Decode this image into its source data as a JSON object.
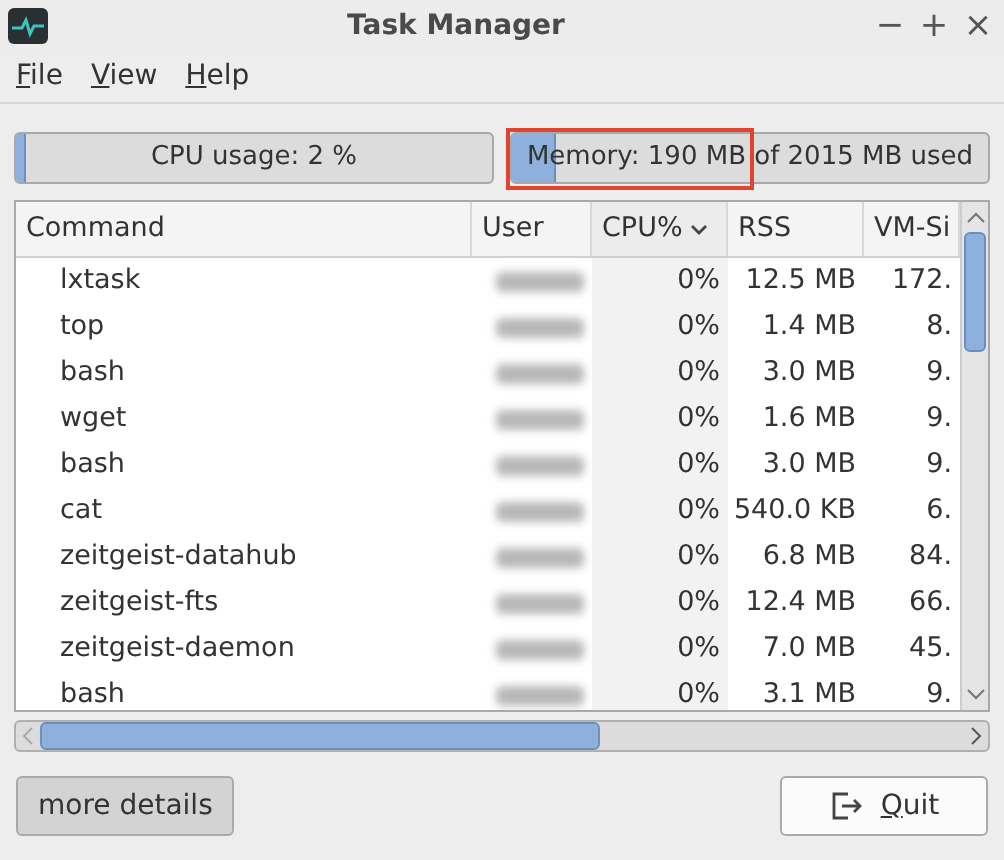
{
  "window": {
    "title": "Task Manager",
    "controls": [
      "−",
      "+",
      "×"
    ]
  },
  "menu": [
    {
      "label": "File",
      "mnemonic": true
    },
    {
      "label": "View",
      "mnemonic": true
    },
    {
      "label": "Help",
      "mnemonic": true
    }
  ],
  "meters": [
    {
      "label": "CPU usage: 2 %",
      "level": 0.02,
      "highlighted": false
    },
    {
      "label": "Memory: 190 MB of 2015 MB used",
      "level": 0.094,
      "highlighted": true
    }
  ],
  "table": {
    "columns": [
      {
        "label": "Command",
        "sorted": false
      },
      {
        "label": "User",
        "sorted": false
      },
      {
        "label": "CPU%",
        "sorted": true
      },
      {
        "label": "RSS",
        "sorted": false
      },
      {
        "label": "VM-Si",
        "sorted": false
      }
    ],
    "rows": [
      {
        "command": "lxtask",
        "user_blurred": true,
        "cpu": "0%",
        "rss": "12.5 MB",
        "vm_si": "172."
      },
      {
        "command": "top",
        "user_blurred": true,
        "cpu": "0%",
        "rss": "1.4 MB",
        "vm_si": "8."
      },
      {
        "command": "bash",
        "user_blurred": true,
        "cpu": "0%",
        "rss": "3.0 MB",
        "vm_si": "9."
      },
      {
        "command": "wget",
        "user_blurred": true,
        "cpu": "0%",
        "rss": "1.6 MB",
        "vm_si": "9."
      },
      {
        "command": "bash",
        "user_blurred": true,
        "cpu": "0%",
        "rss": "3.0 MB",
        "vm_si": "9."
      },
      {
        "command": "cat",
        "user_blurred": true,
        "cpu": "0%",
        "rss": "540.0 KB",
        "vm_si": "6."
      },
      {
        "command": "zeitgeist-datahub",
        "user_blurred": true,
        "cpu": "0%",
        "rss": "6.8 MB",
        "vm_si": "84."
      },
      {
        "command": "zeitgeist-fts",
        "user_blurred": true,
        "cpu": "0%",
        "rss": "12.4 MB",
        "vm_si": "66."
      },
      {
        "command": "zeitgeist-daemon",
        "user_blurred": true,
        "cpu": "0%",
        "rss": "7.0 MB",
        "vm_si": "45."
      },
      {
        "command": "bash",
        "user_blurred": true,
        "cpu": "0%",
        "rss": "3.1 MB",
        "vm_si": "9."
      }
    ]
  },
  "buttons": [
    {
      "label": "more details",
      "kind": "toggle",
      "pressed": true,
      "mnemonic": false
    },
    {
      "label": "Quit",
      "kind": "quit",
      "pressed": false,
      "mnemonic": true
    }
  ]
}
